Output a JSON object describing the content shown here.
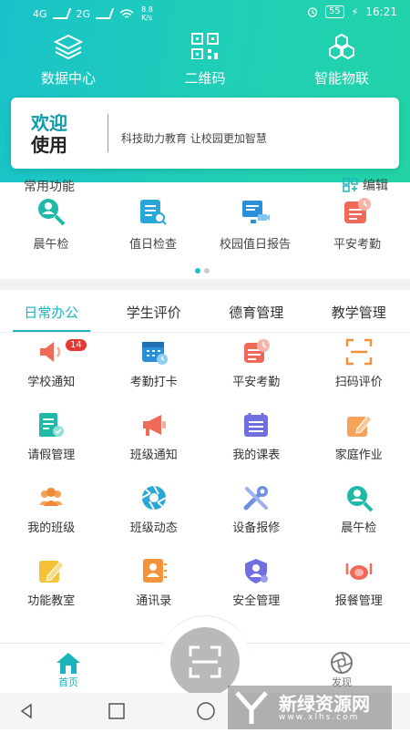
{
  "statusbar": {
    "net1": "4G",
    "net2": "2G",
    "speed": "8.8",
    "speed_unit": "K/s",
    "battery": "55",
    "time": "16:21"
  },
  "topnav": [
    {
      "label": "数据中心",
      "icon": "layers-icon"
    },
    {
      "label": "二维码",
      "icon": "qrcode-icon"
    },
    {
      "label": "智能物联",
      "icon": "hexagon-network-icon"
    }
  ],
  "welcome": {
    "line1": "欢迎",
    "line2": "使用",
    "slogan": "科技助力教育  让校园更加智慧"
  },
  "common": {
    "title": "常用功能",
    "edit": "编辑",
    "items": [
      {
        "label": "晨午检",
        "icon": "search-person-icon"
      },
      {
        "label": "值日检查",
        "icon": "checklist-search-icon"
      },
      {
        "label": "校园值日报告",
        "icon": "report-camera-icon"
      },
      {
        "label": "平安考勤",
        "icon": "clock-card-icon"
      }
    ]
  },
  "tabs": [
    {
      "label": "日常办公",
      "active": true
    },
    {
      "label": "学生评价"
    },
    {
      "label": "德育管理"
    },
    {
      "label": "教学管理"
    }
  ],
  "grid": [
    {
      "label": "学校通知",
      "icon": "speaker-icon",
      "badge": "14"
    },
    {
      "label": "考勤打卡",
      "icon": "calendar-clock-icon"
    },
    {
      "label": "平安考勤",
      "icon": "clock-card-icon"
    },
    {
      "label": "扫码评价",
      "icon": "scan-frame-icon"
    },
    {
      "label": "请假管理",
      "icon": "leave-form-icon"
    },
    {
      "label": "班级通知",
      "icon": "megaphone-icon"
    },
    {
      "label": "我的课表",
      "icon": "schedule-icon"
    },
    {
      "label": "家庭作业",
      "icon": "homework-pencil-icon"
    },
    {
      "label": "我的班级",
      "icon": "group-icon"
    },
    {
      "label": "班级动态",
      "icon": "aperture-icon"
    },
    {
      "label": "设备报修",
      "icon": "tools-icon"
    },
    {
      "label": "晨午检",
      "icon": "search-person-icon"
    },
    {
      "label": "功能教室",
      "icon": "edit-note-icon"
    },
    {
      "label": "通讯录",
      "icon": "contacts-icon"
    },
    {
      "label": "安全管理",
      "icon": "shield-user-icon"
    },
    {
      "label": "报餐管理",
      "icon": "meal-plate-icon"
    }
  ],
  "bottom": {
    "home": "首页",
    "discover": "发现"
  },
  "watermark": {
    "text": "新绿资源网",
    "url": "www.xlhs.com"
  },
  "colors": {
    "accent": "#1db3bd",
    "badge": "#e53935"
  }
}
